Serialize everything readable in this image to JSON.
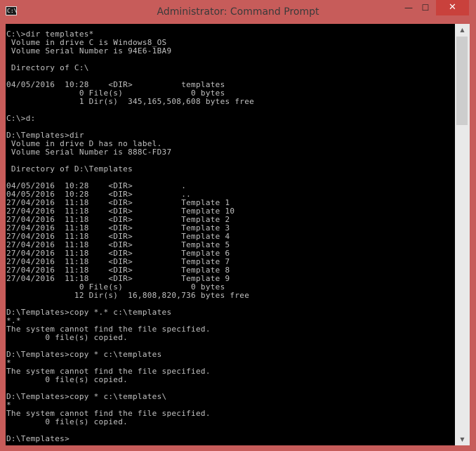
{
  "window": {
    "title": "Administrator: Command Prompt",
    "icon_label": "C:\\",
    "minimize_glyph": "—",
    "maximize_glyph": "☐",
    "close_glyph": "✕"
  },
  "scrollbar": {
    "up_glyph": "▲",
    "down_glyph": "▼"
  },
  "console": {
    "lines": [
      "C:\\>dir templates*",
      " Volume in drive C is Windows8_OS",
      " Volume Serial Number is 94E6-1BA9",
      "",
      " Directory of C:\\",
      "",
      "04/05/2016  10:28    <DIR>          templates",
      "               0 File(s)              0 bytes",
      "               1 Dir(s)  345,165,508,608 bytes free",
      "",
      "C:\\>d:",
      "",
      "D:\\Templates>dir",
      " Volume in drive D has no label.",
      " Volume Serial Number is 888C-FD37",
      "",
      " Directory of D:\\Templates",
      "",
      "04/05/2016  10:28    <DIR>          .",
      "04/05/2016  10:28    <DIR>          ..",
      "27/04/2016  11:18    <DIR>          Template 1",
      "27/04/2016  11:18    <DIR>          Template 10",
      "27/04/2016  11:18    <DIR>          Template 2",
      "27/04/2016  11:18    <DIR>          Template 3",
      "27/04/2016  11:18    <DIR>          Template 4",
      "27/04/2016  11:18    <DIR>          Template 5",
      "27/04/2016  11:18    <DIR>          Template 6",
      "27/04/2016  11:18    <DIR>          Template 7",
      "27/04/2016  11:18    <DIR>          Template 8",
      "27/04/2016  11:18    <DIR>          Template 9",
      "               0 File(s)              0 bytes",
      "              12 Dir(s)  16,808,820,736 bytes free",
      "",
      "D:\\Templates>copy *.* c:\\templates",
      "*.*",
      "The system cannot find the file specified.",
      "        0 file(s) copied.",
      "",
      "D:\\Templates>copy * c:\\templates",
      "*",
      "The system cannot find the file specified.",
      "        0 file(s) copied.",
      "",
      "D:\\Templates>copy * c:\\templates\\",
      "*",
      "The system cannot find the file specified.",
      "        0 file(s) copied.",
      "",
      "D:\\Templates>"
    ]
  }
}
